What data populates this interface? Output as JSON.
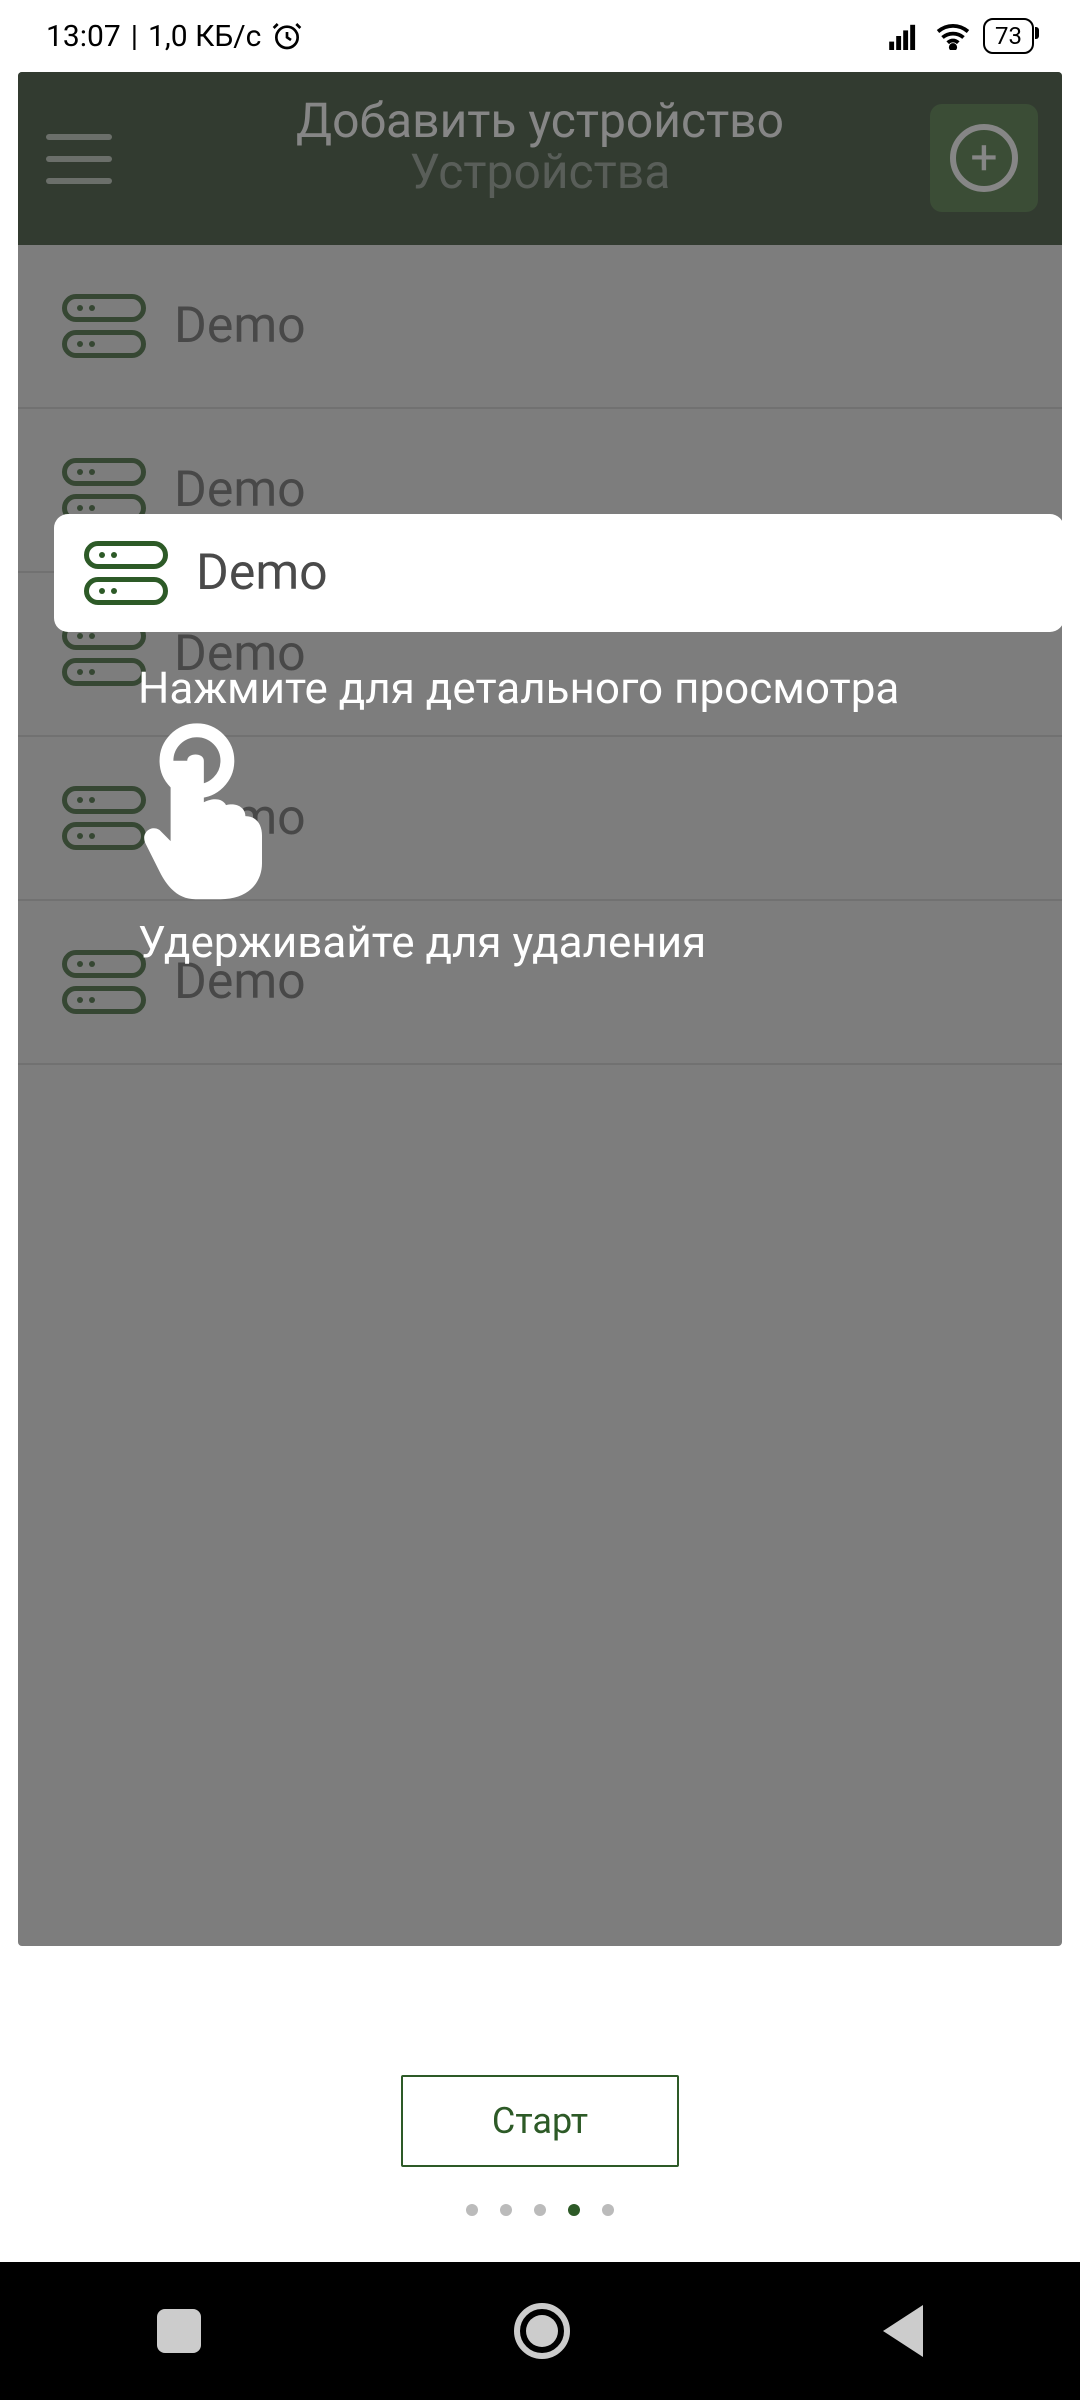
{
  "status": {
    "time": "13:07",
    "speed": "1,0 КБ/с",
    "battery": "73"
  },
  "header": {
    "tooltip": "Добавить устройство",
    "title": "Устройства"
  },
  "devices": [
    {
      "label": "Demo"
    },
    {
      "label": "Demo"
    },
    {
      "label": "Demo"
    },
    {
      "label": "Demo"
    },
    {
      "label": "Demo"
    }
  ],
  "tutorial": {
    "highlight_label": "Demo",
    "tip_tap": "Нажмите для детального просмотра",
    "tip_hold": "Удерживайте для удаления",
    "start_label": "Старт"
  },
  "pager": {
    "count": 5,
    "active_index": 3
  }
}
